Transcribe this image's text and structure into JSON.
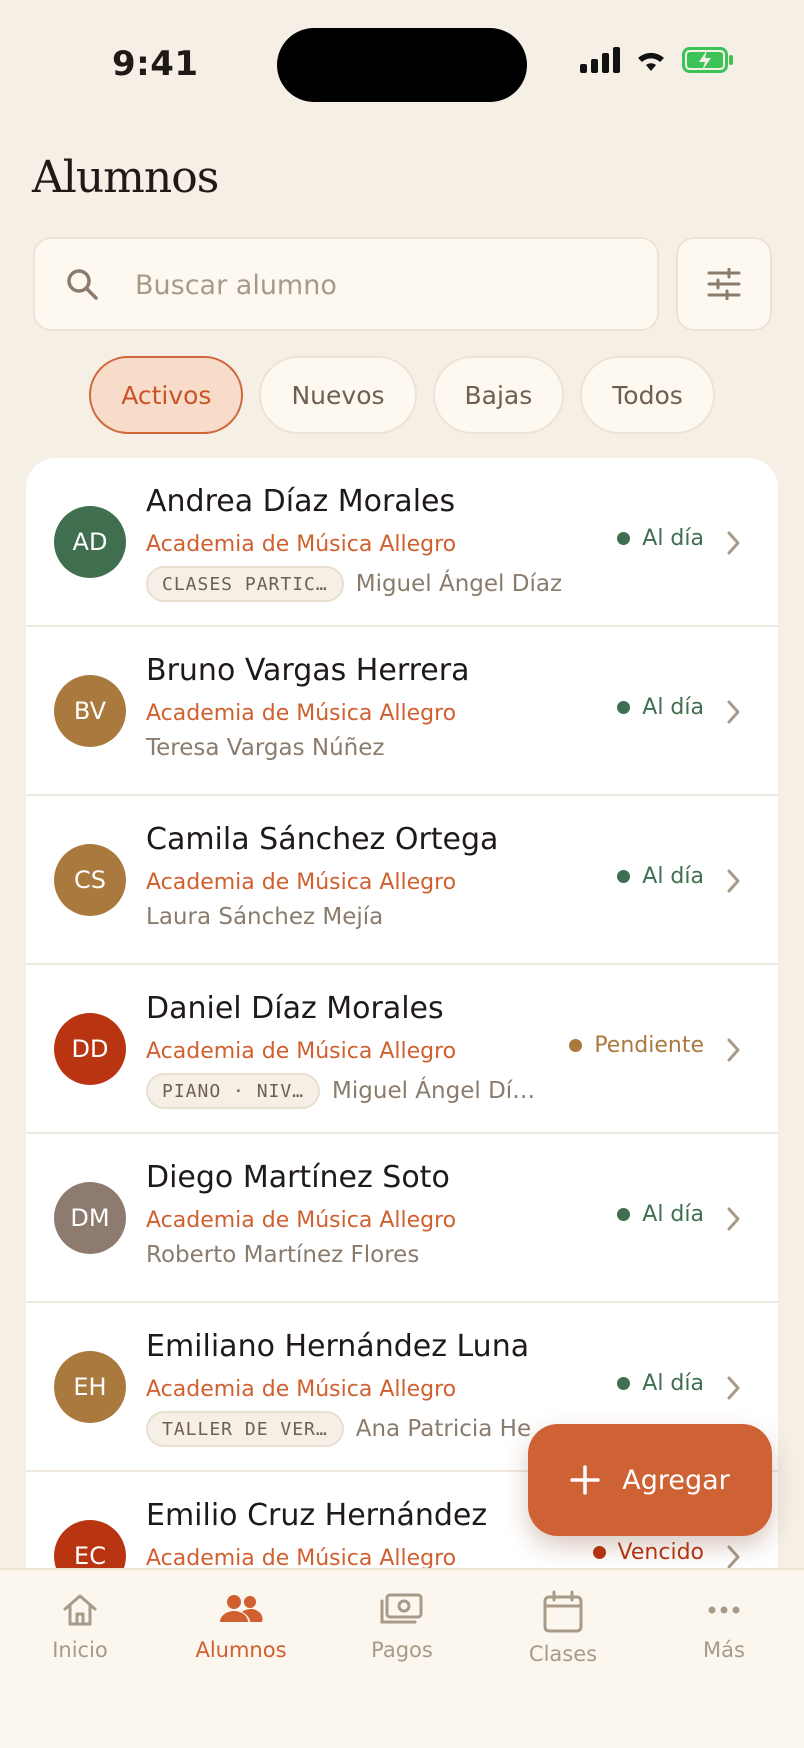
{
  "status_bar": {
    "time": "9:41"
  },
  "page": {
    "title": "Alumnos"
  },
  "search": {
    "placeholder": "Buscar alumno"
  },
  "chips": [
    {
      "label": "Activos",
      "active": true
    },
    {
      "label": "Nuevos",
      "active": false
    },
    {
      "label": "Bajas",
      "active": false
    },
    {
      "label": "Todos",
      "active": false
    }
  ],
  "colors": {
    "accent": "#cf6234",
    "ok": "#3f6f4f",
    "pending": "#a9793e",
    "overdue": "#b93512"
  },
  "students": [
    {
      "initials": "AD",
      "avatar_color": "#3f6f4f",
      "name": "Andrea Díaz Morales",
      "school": "Academia de Música Allegro",
      "tag": "CLASES PARTIC…",
      "tutor": "Miguel Ángel Díaz",
      "status": "Al día",
      "status_color": "#3f6f4f"
    },
    {
      "initials": "BV",
      "avatar_color": "#a9793e",
      "name": "Bruno Vargas Herrera",
      "school": "Academia de Música Allegro",
      "tag": "",
      "tutor": "Teresa Vargas Núñez",
      "status": "Al día",
      "status_color": "#3f6f4f"
    },
    {
      "initials": "CS",
      "avatar_color": "#a9793e",
      "name": "Camila Sánchez Ortega",
      "school": "Academia de Música Allegro",
      "tag": "",
      "tutor": "Laura Sánchez Mejía",
      "status": "Al día",
      "status_color": "#3f6f4f"
    },
    {
      "initials": "DD",
      "avatar_color": "#b93512",
      "name": "Daniel Díaz Morales",
      "school": "Academia de Música Allegro",
      "tag": "PIANO · NIV…",
      "tutor": "Miguel Ángel Dí…",
      "status": "Pendiente",
      "status_color": "#a9793e"
    },
    {
      "initials": "DM",
      "avatar_color": "#8c7b6e",
      "name": "Diego Martínez Soto",
      "school": "Academia de Música Allegro",
      "tag": "",
      "tutor": "Roberto Martínez Flores",
      "status": "Al día",
      "status_color": "#3f6f4f"
    },
    {
      "initials": "EH",
      "avatar_color": "#a9793e",
      "name": "Emiliano Hernández Luna",
      "school": "Academia de Música Allegro",
      "tag": "TALLER DE VER…",
      "tutor": "Ana Patricia He",
      "status": "Al día",
      "status_color": "#3f6f4f"
    },
    {
      "initials": "EC",
      "avatar_color": "#b93512",
      "name": "Emilio Cruz Hernández",
      "school": "Academia de Música Allegro",
      "tag": "",
      "tutor": "",
      "status": "Vencido",
      "status_color": "#b93512"
    }
  ],
  "fab": {
    "label": "Agregar",
    "icon": "plus-icon"
  },
  "tabs": [
    {
      "label": "Inicio",
      "icon": "home-icon",
      "active": false
    },
    {
      "label": "Alumnos",
      "icon": "users-icon",
      "active": true
    },
    {
      "label": "Pagos",
      "icon": "payments-icon",
      "active": false
    },
    {
      "label": "Clases",
      "icon": "calendar-icon",
      "active": false
    },
    {
      "label": "Más",
      "icon": "more-icon",
      "active": false
    }
  ]
}
